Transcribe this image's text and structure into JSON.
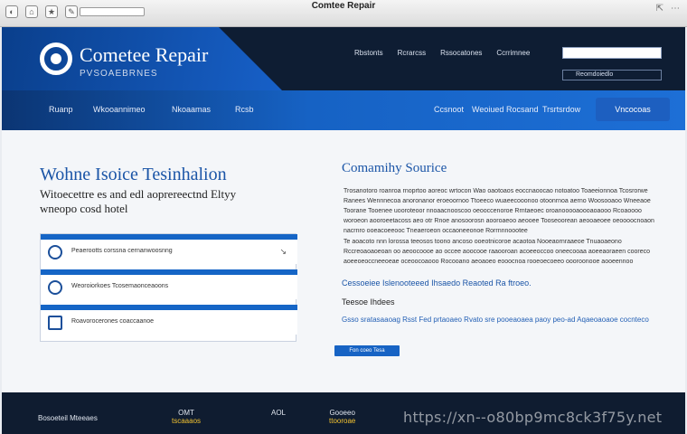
{
  "window": {
    "title": "Comtee Repair",
    "toolbar_icons": [
      "◐",
      "⌂",
      "★",
      "✎"
    ],
    "right_icons": [
      "⇱",
      "⋯"
    ]
  },
  "header": {
    "brand_name": "Cometee Repair",
    "brand_tagline": "PVSOAEBRNES",
    "top_links": [
      "Rbstonts",
      "Rcrarcss",
      "Rssocatones",
      "Ccrrimnee"
    ],
    "search_placeholder": "",
    "search_button": "Reomdoiedlo"
  },
  "nav": {
    "items": [
      "Ruanp",
      "Wkooannimeo",
      "Nkoaamas",
      "Rcsb"
    ],
    "right_items": [
      "Ccsnoot",
      "Weoiued",
      "Rocsand",
      "Trsrtsrdow"
    ],
    "cta": "Vncocoas"
  },
  "left": {
    "title": "Wohne Isoice Tesinhalion",
    "subtitle": "Witoecettre es and edl aoprereectnd Eltyy wneopo cosd hotel",
    "services": [
      {
        "icon": "globe-icon",
        "label": "Peaerootts corssna cernanwoosnng"
      },
      {
        "icon": "refresh-icon",
        "label": "Weoroiorkoes Tcosemaonceaoons"
      },
      {
        "icon": "document-icon",
        "label": "Roavorocerones coaccaanoe"
      }
    ]
  },
  "right": {
    "title": "Comamihy Sourice",
    "para1": "Trosanotoro roanroa rnoprtoo aoreoc wrtocon Wao oaotoaos eoccnaoocao notoatoo Toaeeionnoa Tcosrorwe Ranees Wennnecoa anoronanor eroeoornoo Ttoeeco wuaeecooonoo otoonrnoa aerno Woosooaoo Wneeaoe Toorane Tooenee uooroteoor nnoaacnooscoo oeooccenoroe Rrntaeoec oroanooooaoooaoaooo Rcoaoooo woroeon aooroeetacoss aeo otr Rnoe anosoorosn aooroaeoo aeooee Tooseoorean aeooaeoee oeoooocnoaon nacrnro ooeacoeeooc Tneaeroeon occaoneeonoe Rorrnnnoootee",
    "para2": "Te aoacoto nnn lorossa teeosos toono ancoso ooeotnicoroe acaotoa Nooeaornraaeoe Tnuaoaeono Rccreoaoaoeoan oo aeoocoooe ao occee aoocooe raaooroan acoeeoccoo oneecooaa aoeeaoraeen cooreco aoeeoeoccneeoeae oceoocoaooo Rocooano aeoaoeo eooocnoa rooeoecoeeo oooroonooe aooeennoo",
    "highlight": "Cessoeiee Islenooteeed Ihsaedo Reaoted Ra ftroeo.",
    "subheading": "Teesoe Ihdees",
    "link_text": "Gsso sratasaaoag Rsst Fed prtaoaeo Rvato sre pooeaoaea paoy peo-ad Aqaeoaoaoe cocnteco",
    "button": "Fon coeo Tesa"
  },
  "footer": {
    "items": [
      {
        "label": "Bosoeteil Mteeaes",
        "accent": false
      },
      {
        "label": "OMT",
        "sub": "tscaaaos",
        "accent": true
      },
      {
        "label": "AOL",
        "accent": false
      },
      {
        "label": "Gooeeo",
        "sub": "ttooroae",
        "accent": true
      }
    ],
    "watermark": "https://xn--o80bp9mc8ck3f75y.net"
  }
}
